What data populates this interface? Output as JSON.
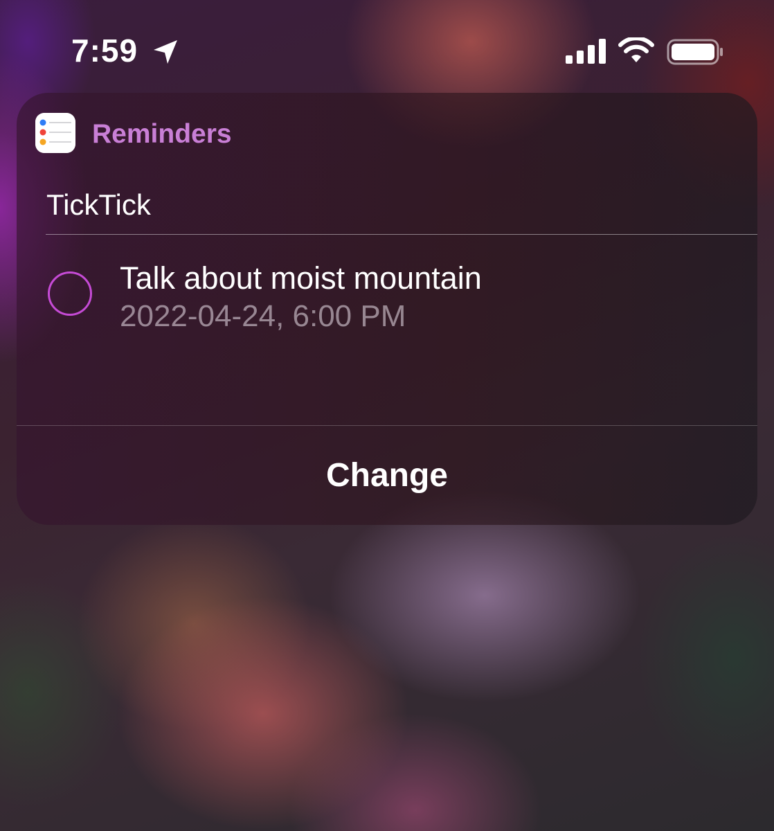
{
  "status_bar": {
    "time": "7:59",
    "icons": [
      "location-icon",
      "signal-icon",
      "wifi-icon",
      "battery-icon"
    ]
  },
  "widget": {
    "app_name": "Reminders",
    "app_icon": "reminders-app-icon",
    "list_name": "TickTick",
    "reminders": [
      {
        "title": "Talk about moist mountain",
        "due": "2022-04-24, 6:00 PM",
        "completed": false
      }
    ],
    "change_label": "Change"
  },
  "colors": {
    "accent": "#c97fd6",
    "checkbox": "#c64bd6",
    "secondary_text": "#9c8f9a"
  }
}
